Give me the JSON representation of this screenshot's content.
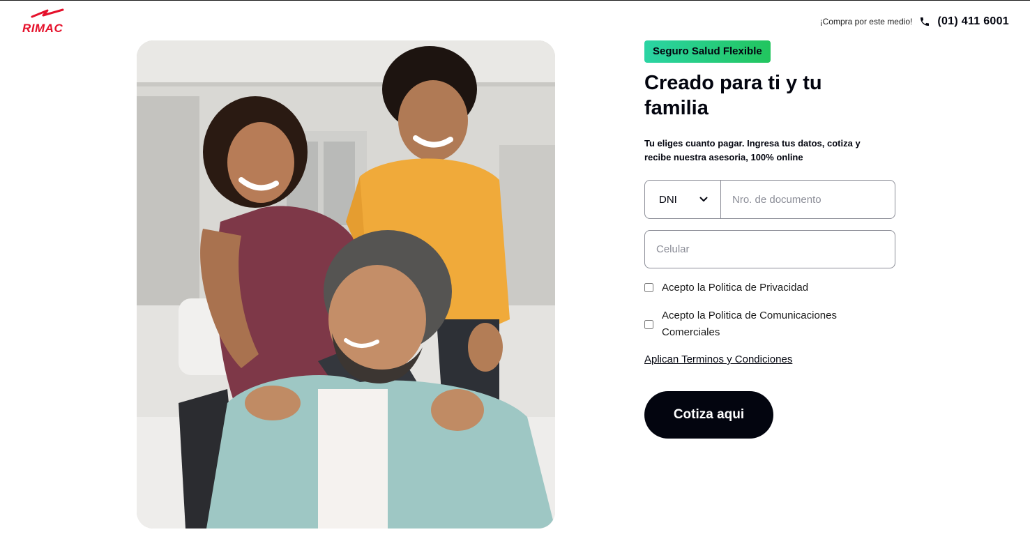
{
  "header": {
    "logo_text": "RIMAC",
    "buy_text": "¡Compra por este medio!",
    "phone": "(01) 411 6001",
    "phone_icon": "phone-icon"
  },
  "hero": {
    "image": "family-photo"
  },
  "form": {
    "badge": "Seguro Salud Flexible",
    "title": "Creado para ti y tu familia",
    "subtitle": "Tu eliges cuanto pagar. Ingresa tus datos, cotiza y recibe nuestra asesoria, 100% online",
    "doc_type": "DNI",
    "doc_placeholder": "Nro. de documento",
    "cel_placeholder": "Celular",
    "privacy_label": "Acepto la Politica de Privacidad",
    "comms_label": "Acepto la Politica de Comunicaciones Comerciales",
    "terms_link": "Aplican Terminos y Condiciones",
    "cta_label": "Cotiza aqui"
  },
  "colors": {
    "brand_red": "#e5112b",
    "badge_gradient_start": "#2bd4a4",
    "badge_gradient_end": "#22c55e",
    "cta_bg": "#03050f"
  }
}
